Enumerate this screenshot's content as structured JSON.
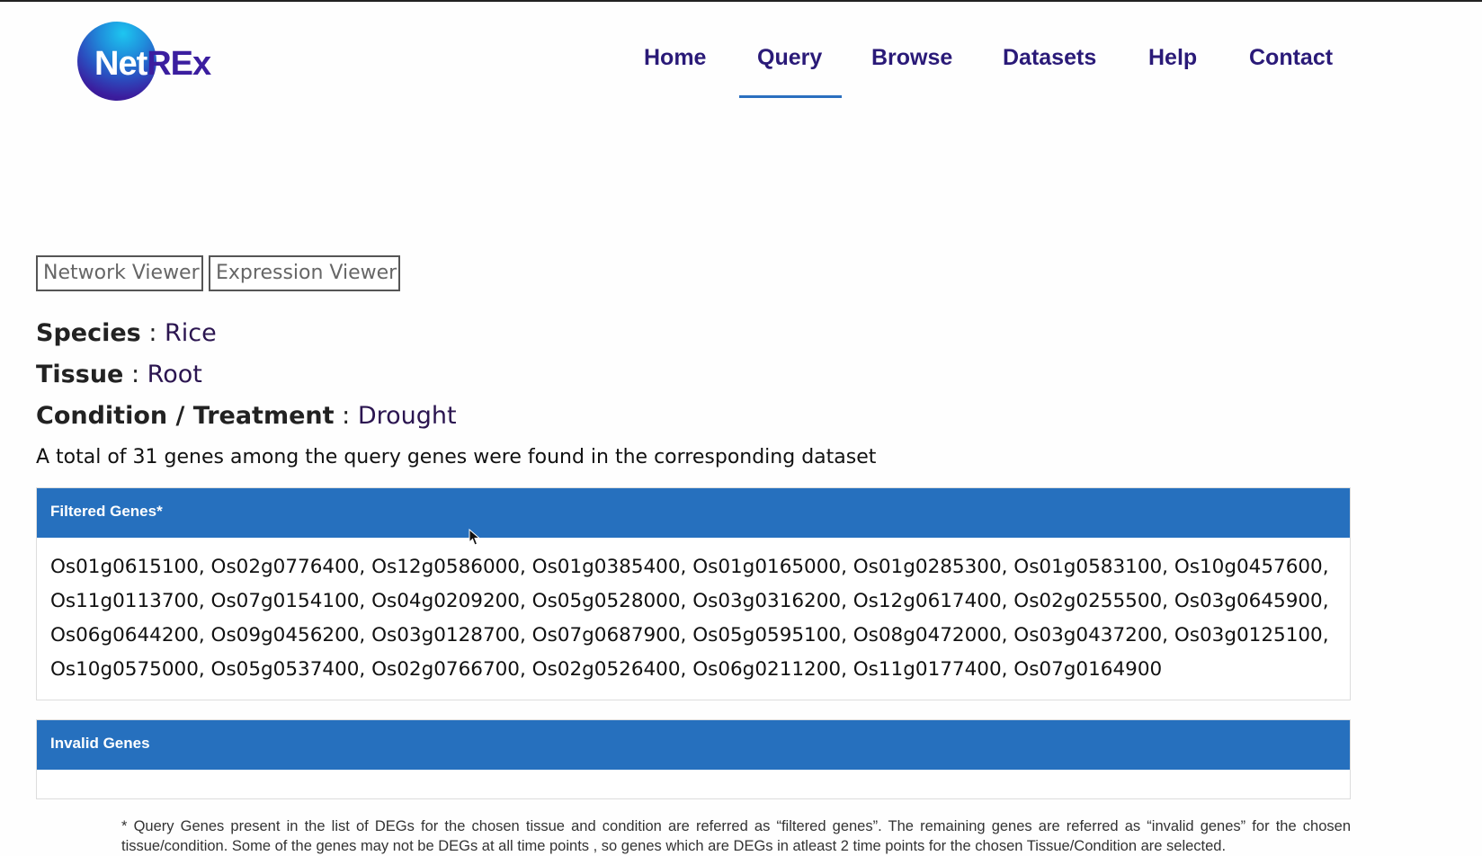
{
  "logo": {
    "text_white": "Net",
    "text_purple": "REx"
  },
  "nav": {
    "items": [
      "Home",
      "Query",
      "Browse",
      "Datasets",
      "Help",
      "Contact"
    ],
    "active": "Query"
  },
  "viewers": {
    "network": "Network Viewer",
    "expression": "Expression Viewer"
  },
  "meta": {
    "species_label": "Species",
    "species": "Rice",
    "tissue_label": "Tissue",
    "tissue": "Root",
    "condition_label": "Condition / Treatment",
    "condition": "Drought",
    "separator": ":"
  },
  "total_text": "A total of 31 genes among the query genes were found in the corresponding dataset",
  "filtered": {
    "title": "Filtered Genes*",
    "genes": "Os01g0615100, Os02g0776400, Os12g0586000, Os01g0385400, Os01g0165000, Os01g0285300, Os01g0583100, Os10g0457600, Os11g0113700, Os07g0154100, Os04g0209200, Os05g0528000, Os03g0316200, Os12g0617400, Os02g0255500, Os03g0645900, Os06g0644200, Os09g0456200, Os03g0128700, Os07g0687900, Os05g0595100, Os08g0472000, Os03g0437200, Os03g0125100, Os10g0575000, Os05g0537400, Os02g0766700, Os02g0526400, Os06g0211200, Os11g0177400, Os07g0164900"
  },
  "invalid": {
    "title": "Invalid Genes",
    "genes": ""
  },
  "footnote": "* Query Genes present in the list of DEGs for the chosen tissue and condition are referred as “filtered genes”. The remaining genes are referred as “invalid genes” for the chosen tissue/condition. Some of the genes may not be DEGs at all time points , so genes which are DEGs in atleast 2 time points for the chosen Tissue/Condition are selected.",
  "colors": {
    "accent": "#2670be",
    "nav_text": "#2a1a78",
    "value_text": "#2b1550"
  }
}
